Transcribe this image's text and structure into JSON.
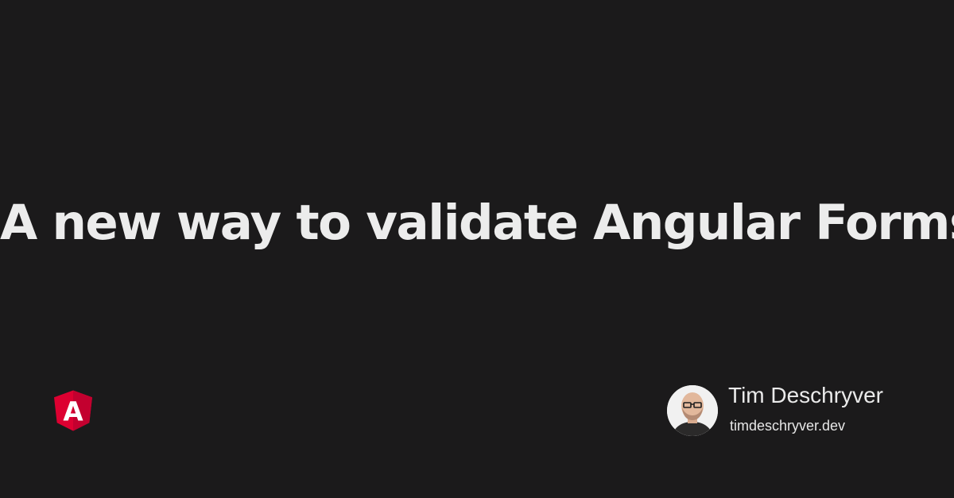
{
  "title": "A new way to validate Angular Forms",
  "author": {
    "name": "Tim Deschryver",
    "site": "timdeschryver.dev",
    "avatar_icon": "author-photo"
  },
  "logo": {
    "icon": "angular-logo-icon",
    "letter": "A",
    "color_primary": "#dd0031",
    "color_secondary": "#c3002f"
  },
  "colors": {
    "background": "#1b1a1b",
    "text": "#ececec"
  }
}
